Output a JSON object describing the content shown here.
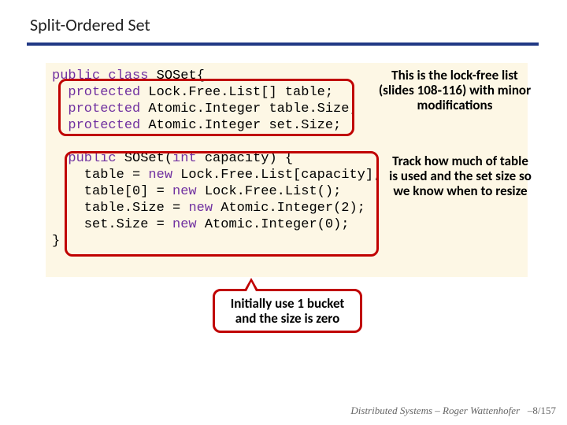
{
  "title": "Split-Ordered Set",
  "code": {
    "l1a": "public",
    "l1b": " class",
    "l1c": " SOSet{",
    "l2a": "  protected",
    "l2b": " Lock.Free.List[] table;",
    "l3a": "  protected",
    "l3b": " Atomic.Integer table.Size;",
    "l4a": "  protected",
    "l4b": " Atomic.Integer set.Size;",
    "blank1": "",
    "l6a": "  public",
    "l6b": " SOSet(",
    "l6c": "int",
    "l6d": " capacity) {",
    "l7a": "    table = ",
    "l7b": "new",
    "l7c": " Lock.Free.List[capacity];",
    "l8a": "    table[0] = ",
    "l8b": "new",
    "l8c": " Lock.Free.List();",
    "l9a": "    table.Size = ",
    "l9b": "new",
    "l9c": " Atomic.Integer(2);",
    "l10a": "    set.Size = ",
    "l10b": "new",
    "l10c": " Atomic.Integer(0);",
    "l11": "}"
  },
  "callouts": {
    "right1": "This is the lock-free list (slides 108‑116) with minor modifications",
    "right2": "Track how much of table is used and the set size so we know when to resize",
    "bottom": "Initially use 1 bucket and the size is zero"
  },
  "footer": {
    "course": "Distributed Systems",
    "sep": " – ",
    "author": "Roger Wattenhofer",
    "page": "–8/157"
  }
}
